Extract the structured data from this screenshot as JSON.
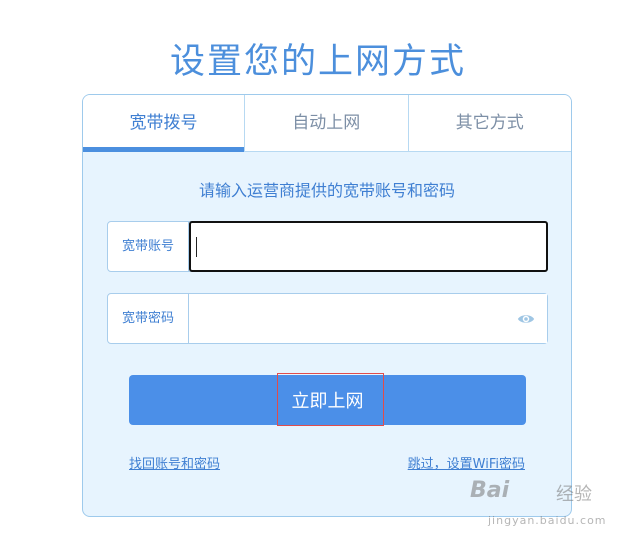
{
  "page": {
    "title": "设置您的上网方式"
  },
  "tabs": [
    {
      "label": "宽带拨号",
      "active": true
    },
    {
      "label": "自动上网",
      "active": false
    },
    {
      "label": "其它方式",
      "active": false
    }
  ],
  "form": {
    "subtitle": "请输入运营商提供的宽带账号和密码",
    "account": {
      "label": "宽带账号",
      "value": "",
      "placeholder": ""
    },
    "password": {
      "label": "宽带密码",
      "value": "",
      "placeholder": ""
    },
    "submit_label": "立即上网",
    "eye_icon": "eye-icon"
  },
  "links": {
    "recover": "找回账号和密码",
    "skip": "跳过，设置WiFi密码"
  },
  "watermark": {
    "brand": "Bai",
    "brand2": "经验",
    "url": "jingyan.baidu.com"
  },
  "colors": {
    "accent": "#4b8fe8",
    "title": "#4c8fdc",
    "card_bg": "#e7f4fe",
    "border": "#9ecaec",
    "highlight": "#e04c4c"
  }
}
